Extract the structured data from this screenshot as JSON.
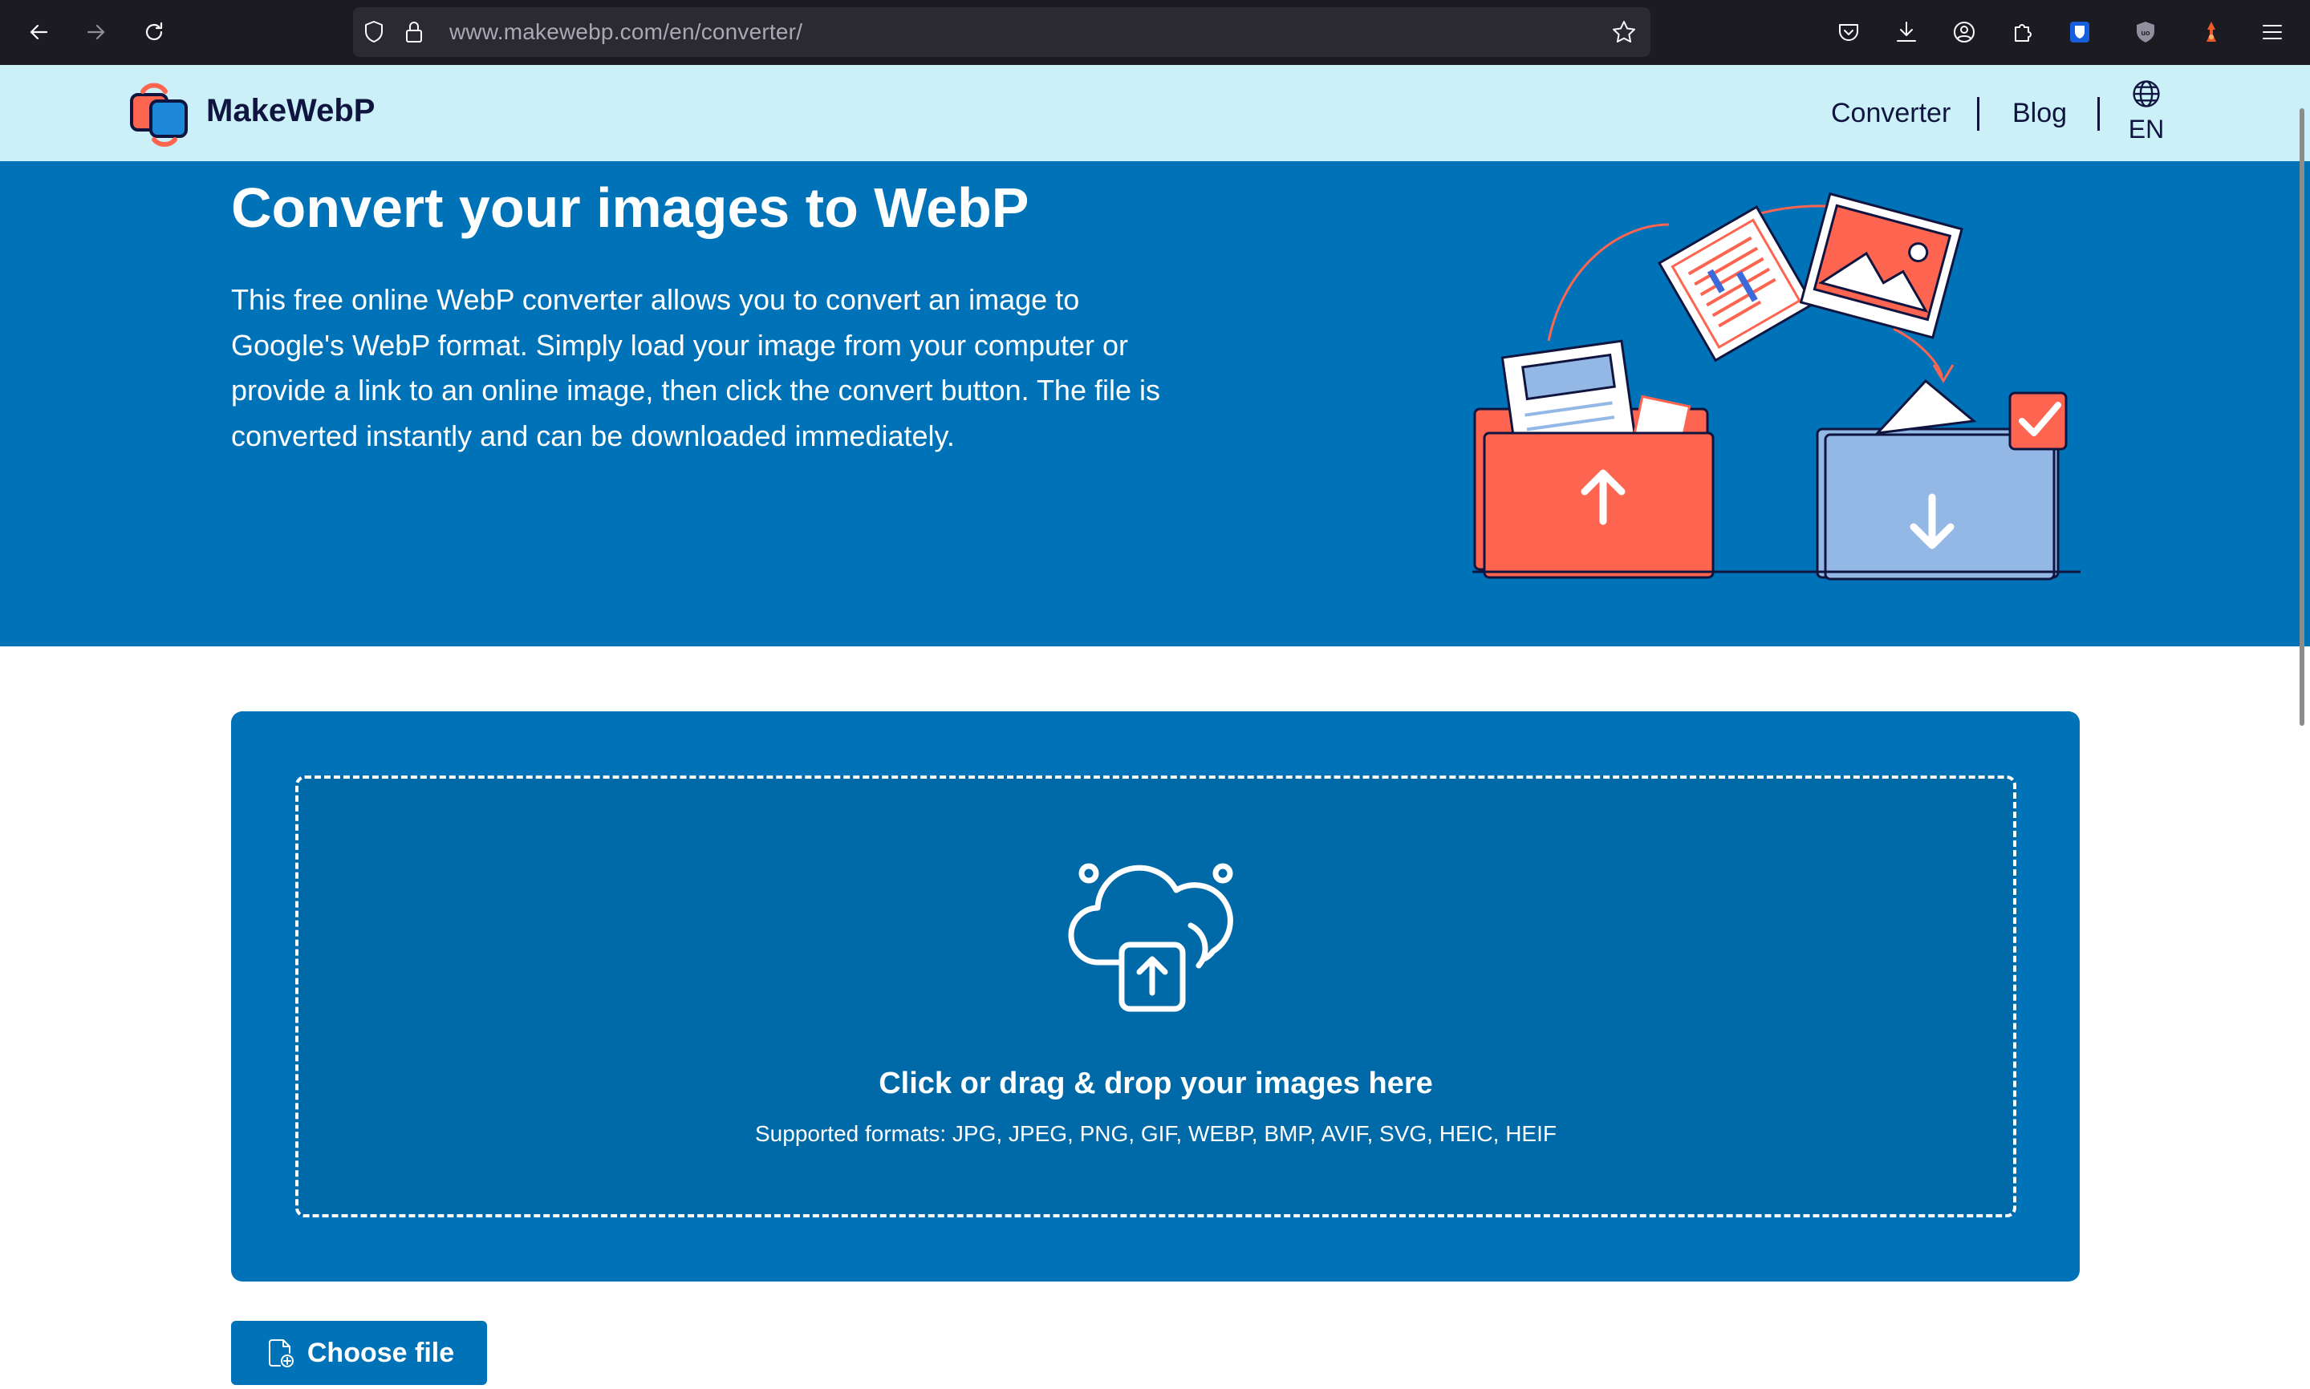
{
  "browser": {
    "url_host": "www.makewebp.com",
    "url_path": "/en/converter/",
    "icons": [
      "back-icon",
      "forward-icon",
      "reload-icon",
      "shield-icon",
      "lock-icon",
      "star-icon",
      "pocket-icon",
      "download-icon",
      "account-icon",
      "extensions-icon",
      "bitwarden-icon",
      "ublock-icon",
      "extension-icon",
      "menu-icon"
    ]
  },
  "header": {
    "brand": "MakeWebP",
    "nav": [
      {
        "label": "Converter"
      },
      {
        "label": "Blog"
      }
    ],
    "language": "EN"
  },
  "hero": {
    "title": "Convert your images to WebP",
    "description": "This free online WebP converter allows you to convert an image to Google's WebP format. Simply load your image from your computer or provide a link to an online image, then click the convert button. The file is converted instantly and can be downloaded immediately."
  },
  "upload": {
    "title": "Click or drag & drop your images here",
    "formats": "Supported formats: JPG, JPEG, PNG, GIF, WEBP, BMP, AVIF, SVG, HEIC, HEIF",
    "choose_label": "Choose file"
  },
  "colors": {
    "hero_bg": "#0072b8",
    "header_bg": "#cbf0f8",
    "accent_red": "#fd6550",
    "folder_blue": "#93b8e6",
    "brand_text": "#101540"
  }
}
